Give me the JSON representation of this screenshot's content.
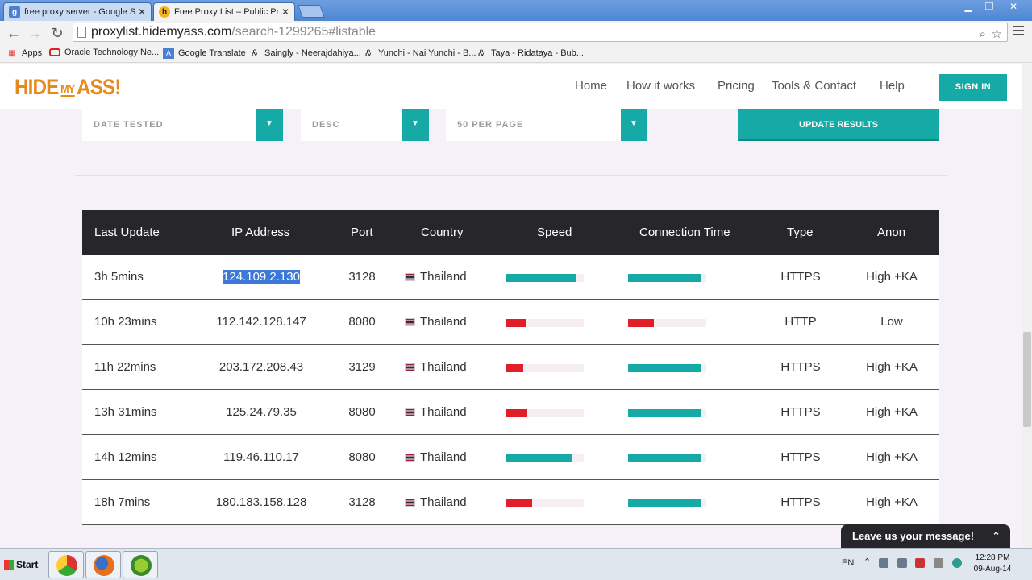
{
  "browser": {
    "tabs": [
      {
        "title": "free proxy server - Google S",
        "icon": "google-icon"
      },
      {
        "title": "Free Proxy List – Public Prox",
        "icon": "hidemyass-icon"
      }
    ],
    "url_host": "proxylist.hidemyass.com",
    "url_path": "/search-1299265#listable",
    "bookmarks": [
      "Apps",
      "Oracle Technology Ne...",
      "Google Translate",
      "Saingly - Neerajdahiya...",
      "Yunchi - Nai Yunchi - B...",
      "Taya - Ridataya - Bub..."
    ]
  },
  "site": {
    "logo": {
      "left": "HIDE",
      "mid": "MY",
      "right": "ASS!"
    },
    "nav": [
      "Home",
      "How it works",
      "Pricing",
      "Tools & Contact",
      "Help"
    ],
    "signin": "SIGN IN"
  },
  "filters": {
    "sort_by": "DATE TESTED",
    "order": "DESC",
    "per_page": "50 PER PAGE",
    "update_button": "UPDATE RESULTS"
  },
  "table": {
    "headers": [
      "Last Update",
      "IP Address",
      "Port",
      "Country",
      "Speed",
      "Connection Time",
      "Type",
      "Anon"
    ],
    "rows": [
      {
        "last_update": "3h 5mins",
        "ip": "124.109.2.130",
        "port": "3128",
        "country": "Thailand",
        "speed": 0.9,
        "speed_level": "fast",
        "conn": 0.94,
        "conn_level": "fast",
        "type": "HTTPS",
        "anon": "High +KA"
      },
      {
        "last_update": "10h 23mins",
        "ip": "112.142.128.147",
        "port": "8080",
        "country": "Thailand",
        "speed": 0.27,
        "speed_level": "slow",
        "conn": 0.33,
        "conn_level": "slow",
        "type": "HTTP",
        "anon": "Low"
      },
      {
        "last_update": "11h 22mins",
        "ip": "203.172.208.43",
        "port": "3129",
        "country": "Thailand",
        "speed": 0.23,
        "speed_level": "slow",
        "conn": 0.93,
        "conn_level": "fast",
        "type": "HTTPS",
        "anon": "High +KA"
      },
      {
        "last_update": "13h 31mins",
        "ip": "125.24.79.35",
        "port": "8080",
        "country": "Thailand",
        "speed": 0.28,
        "speed_level": "slow",
        "conn": 0.94,
        "conn_level": "fast",
        "type": "HTTPS",
        "anon": "High +KA"
      },
      {
        "last_update": "14h 12mins",
        "ip": "119.46.110.17",
        "port": "8080",
        "country": "Thailand",
        "speed": 0.85,
        "speed_level": "fast",
        "conn": 0.93,
        "conn_level": "fast",
        "type": "HTTPS",
        "anon": "High +KA"
      },
      {
        "last_update": "18h 7mins",
        "ip": "180.183.158.128",
        "port": "3128",
        "country": "Thailand",
        "speed": 0.34,
        "speed_level": "slow",
        "conn": 0.93,
        "conn_level": "fast",
        "type": "HTTPS",
        "anon": "High +KA"
      }
    ]
  },
  "chat": {
    "label": "Leave us your message!"
  },
  "taskbar": {
    "start": "Start",
    "lang": "EN",
    "time": "12:28 PM",
    "date": "09-Aug-14"
  }
}
